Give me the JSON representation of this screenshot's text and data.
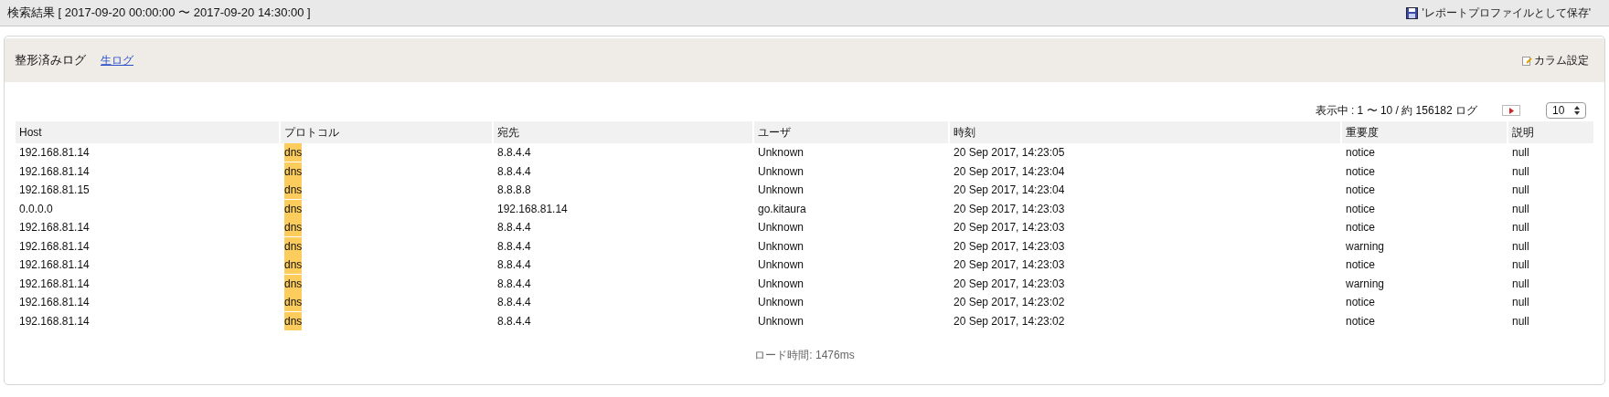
{
  "search_bar": {
    "title": "検索結果 [ 2017-09-20 00:00:00 〜 2017-09-20 14:30:00 ]",
    "save_link": "'レポートプロファイルとして保存'"
  },
  "panel": {
    "tabs": [
      {
        "label": "整形済みログ",
        "selected": true
      },
      {
        "label": "生ログ",
        "selected": false
      }
    ],
    "column_settings": "カラム設定",
    "pager": {
      "summary": "表示中 : 1 〜 10 / 約 156182 ログ",
      "page_size": "10"
    },
    "table": {
      "columns": [
        "Host",
        "プロトコル",
        "宛先",
        "ユーザ",
        "時刻",
        "重要度",
        "説明"
      ],
      "rows": [
        {
          "cells": [
            "192.168.81.14",
            "dns",
            "8.8.4.4",
            "Unknown",
            "20 Sep 2017, 14:23:05",
            "notice",
            "null"
          ],
          "highlighted": true
        },
        {
          "cells": [
            "192.168.81.14",
            "dns",
            "8.8.4.4",
            "Unknown",
            "20 Sep 2017, 14:23:04",
            "notice",
            "null"
          ],
          "highlighted": true
        },
        {
          "cells": [
            "192.168.81.15",
            "dns",
            "8.8.8.8",
            "Unknown",
            "20 Sep 2017, 14:23:04",
            "notice",
            "null"
          ],
          "highlighted": true
        },
        {
          "cells": [
            "0.0.0.0",
            "dns",
            "192.168.81.14",
            "go.kitaura",
            "20 Sep 2017, 14:23:03",
            "notice",
            "null"
          ],
          "highlighted": true
        },
        {
          "cells": [
            "192.168.81.14",
            "dns",
            "8.8.4.4",
            "Unknown",
            "20 Sep 2017, 14:23:03",
            "notice",
            "null"
          ],
          "highlighted": true
        },
        {
          "cells": [
            "192.168.81.14",
            "dns",
            "8.8.4.4",
            "Unknown",
            "20 Sep 2017, 14:23:03",
            "warning",
            "null"
          ],
          "highlighted": true
        },
        {
          "cells": [
            "192.168.81.14",
            "dns",
            "8.8.4.4",
            "Unknown",
            "20 Sep 2017, 14:23:03",
            "notice",
            "null"
          ],
          "highlighted": true
        },
        {
          "cells": [
            "192.168.81.14",
            "dns",
            "8.8.4.4",
            "Unknown",
            "20 Sep 2017, 14:23:03",
            "warning",
            "null"
          ],
          "highlighted": true
        },
        {
          "cells": [
            "192.168.81.14",
            "dns",
            "8.8.4.4",
            "Unknown",
            "20 Sep 2017, 14:23:02",
            "notice",
            "null"
          ],
          "highlighted": true
        },
        {
          "cells": [
            "192.168.81.14",
            "dns",
            "8.8.4.4",
            "Unknown",
            "20 Sep 2017, 14:23:02",
            "notice",
            "null"
          ],
          "highlighted": true
        }
      ]
    },
    "footer": "ロード時間: 1476ms"
  }
}
